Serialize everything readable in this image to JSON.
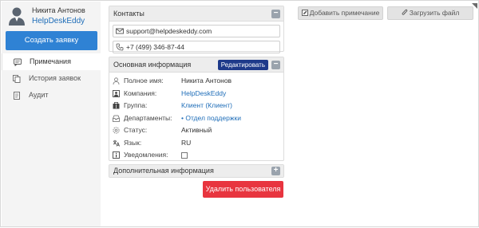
{
  "user": {
    "name": "Никита Антонов",
    "company": "HelpDeskEddy"
  },
  "sidebar": {
    "create_button": "Создать заявку",
    "items": [
      {
        "label": "Примечания",
        "icon": "comment-icon",
        "active": true
      },
      {
        "label": "История заявок",
        "icon": "copy-icon",
        "active": false
      },
      {
        "label": "Аудит",
        "icon": "document-icon",
        "active": false
      }
    ]
  },
  "contacts": {
    "title": "Контакты",
    "collapse_symbol": "−",
    "email": "support@helpdeskeddy.com",
    "phone": "+7 (499) 346-87-44"
  },
  "main_info": {
    "title": "Основная информация",
    "edit_button": "Редактировать",
    "collapse_symbol": "−",
    "rows": [
      {
        "label": "Полное имя:",
        "value": "Никита Антонов",
        "link": false
      },
      {
        "label": "Компания:",
        "value": "HelpDeskEddy",
        "link": true
      },
      {
        "label": "Группа:",
        "value": "Клиент (Клиент)",
        "link": true
      },
      {
        "label": "Департаменты:",
        "value": "• Отдел поддержки",
        "link": true
      },
      {
        "label": "Статус:",
        "value": "Активный",
        "link": false
      },
      {
        "label": "Язык:",
        "value": "RU",
        "link": false
      },
      {
        "label": "Уведомления:",
        "value": "",
        "link": false,
        "checkbox": true,
        "checked": false
      }
    ]
  },
  "extra_info": {
    "title": "Дополнительная информация",
    "expand_symbol": "+"
  },
  "delete_button": "Удалить пользователя",
  "toolbar": {
    "add_note": "Добавить примечание",
    "upload_file": "Загрузить файл"
  },
  "colors": {
    "primary": "#2f82d4",
    "danger": "#e8353f",
    "edit": "#1e3a8a",
    "link": "#1e6db8"
  }
}
